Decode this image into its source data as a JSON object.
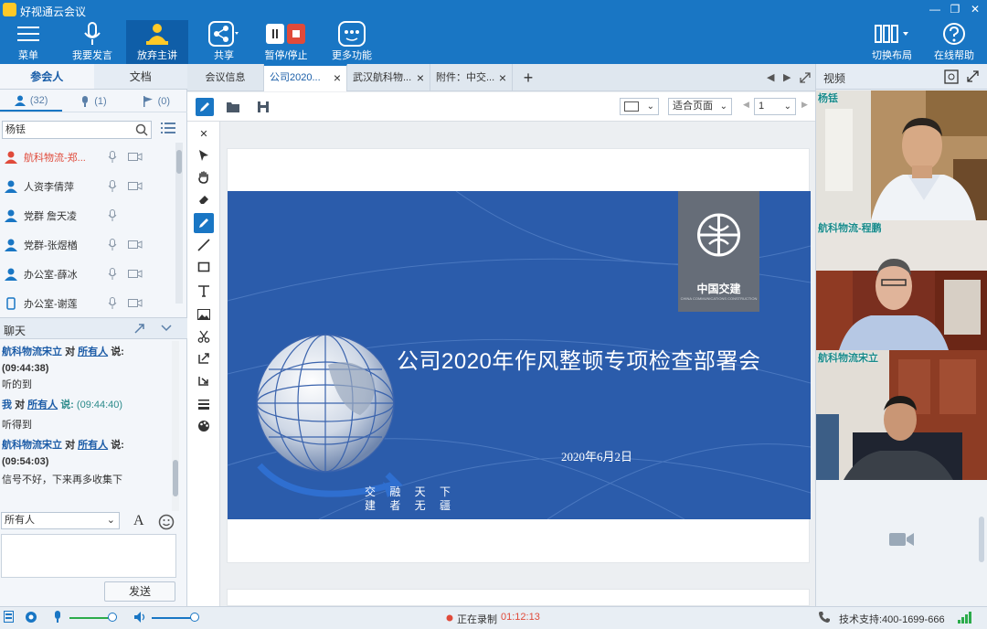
{
  "app": {
    "title": "好视通云会议"
  },
  "toolbar": {
    "menu": "菜单",
    "speak": "我要发言",
    "host": "放弃主讲",
    "share": "共享",
    "pause": "暂停/停止",
    "more": "更多功能",
    "layout": "切换布局",
    "help": "在线帮助"
  },
  "left": {
    "tabs": [
      "参会人",
      "文档"
    ],
    "counts": {
      "people": "(32)",
      "mic": "(1)",
      "flag": "(0)"
    },
    "search_value": "杨铥",
    "participants": [
      {
        "name": "航科物流-郑...",
        "color": "#e04a3a"
      },
      {
        "name": "人资李倩萍",
        "color": "#1976c4"
      },
      {
        "name": "党群 詹天凌",
        "color": "#1976c4"
      },
      {
        "name": "党群-张煜楢",
        "color": "#1976c4"
      },
      {
        "name": "办公室-薛冰",
        "color": "#1976c4"
      },
      {
        "name": "办公室-谢莲",
        "color": "#1976c4"
      }
    ],
    "chat_title": "聊天",
    "chat": {
      "m1_from": "航科物流宋立",
      "m1_to_word": "对",
      "m1_to": "所有人",
      "m1_say": "说:",
      "m1_time": "(09:44:38)",
      "m1_text": "听的到",
      "m2_from": "我",
      "m2_to_word": "对",
      "m2_to": "所有人",
      "m2_say": "说:",
      "m2_time": "(09:44:40)",
      "m2_text": "听得到",
      "m3_from": "航科物流宋立",
      "m3_to_word": "对",
      "m3_to": "所有人",
      "m3_say": "说:",
      "m3_time": "(09:54:03)",
      "m3_text": "信号不好，下来再多收集下"
    },
    "recipient": "所有人",
    "send": "发送"
  },
  "doc": {
    "tabs": [
      {
        "label": "会议信息",
        "closable": false
      },
      {
        "label": "公司2020...",
        "closable": true
      },
      {
        "label": "武汉航科物...",
        "closable": true
      },
      {
        "label": "附件：中交...",
        "closable": true
      }
    ],
    "fit_label": "适合页面",
    "page_number": "1",
    "slide": {
      "title": "公司2020年作风整顿专项检查部署会",
      "date": "2020年6月2日",
      "motto_line1": "交 融 天 下",
      "motto_line2": "建 者 无 疆",
      "logo_text": "中国交建",
      "logo_sub": "CHINA COMMUNICATIONS CONSTRUCTION"
    }
  },
  "right": {
    "title": "视频",
    "videos": [
      {
        "name": "杨铥"
      },
      {
        "name": "航科物流-程鹏"
      },
      {
        "name": "航科物流宋立"
      }
    ]
  },
  "status": {
    "recording": "正在录制",
    "rec_time": "01:12:13",
    "support": "技术支持:400-1699-666"
  },
  "colors": {
    "brand": "#1976c4",
    "slide_bg": "#2b5cab",
    "record": "#e04a3a"
  }
}
